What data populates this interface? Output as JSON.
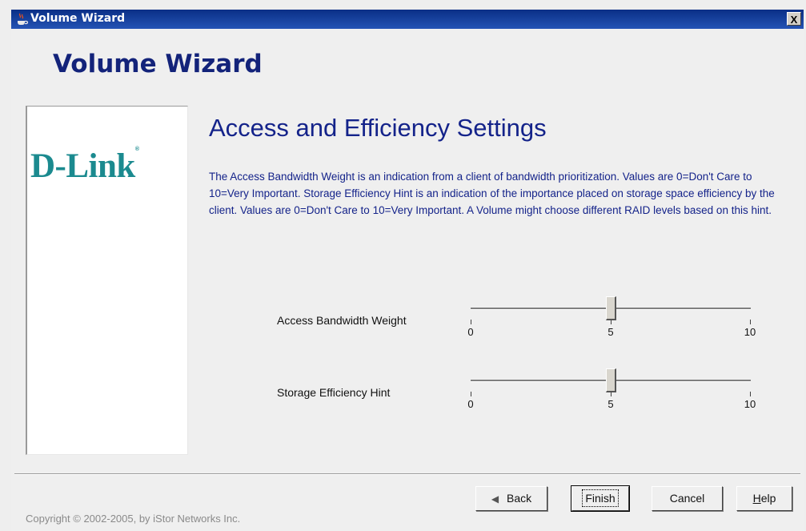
{
  "window": {
    "title": "Volume Wizard",
    "close_label": "X"
  },
  "header": {
    "wizard_title": "Volume Wizard"
  },
  "logo": {
    "text": "D-Link",
    "mark": "®"
  },
  "content": {
    "section_title": "Access and Efficiency Settings",
    "description": "The Access Bandwidth Weight is an indication from a client of bandwidth prioritization. Values are 0=Don't Care to 10=Very Important. Storage Efficiency Hint is an indication of the importance placed on storage space efficiency by the client. Values are 0=Don't Care to 10=Very Important. A Volume might choose different RAID levels based on this hint."
  },
  "sliders": [
    {
      "label": "Access Bandwidth Weight",
      "value": 5,
      "min": 0,
      "max": 10,
      "tick_labels": [
        "0",
        "5",
        "10"
      ]
    },
    {
      "label": "Storage Efficiency Hint",
      "value": 5,
      "min": 0,
      "max": 10,
      "tick_labels": [
        "0",
        "5",
        "10"
      ]
    }
  ],
  "buttons": {
    "back": {
      "label": "Back",
      "icon": "back-arrow-icon",
      "enabled": false
    },
    "finish": {
      "label": "Finish",
      "default": true
    },
    "cancel": {
      "label": "Cancel"
    },
    "help": {
      "label": "Help",
      "mnemonic": "H",
      "rest": "elp"
    }
  },
  "footer": {
    "copyright": "Copyright © 2002-2005, by iStor Networks Inc."
  },
  "colors": {
    "title_bar": "#0a2f86",
    "heading": "#13237a",
    "logo": "#1b8a8f"
  }
}
